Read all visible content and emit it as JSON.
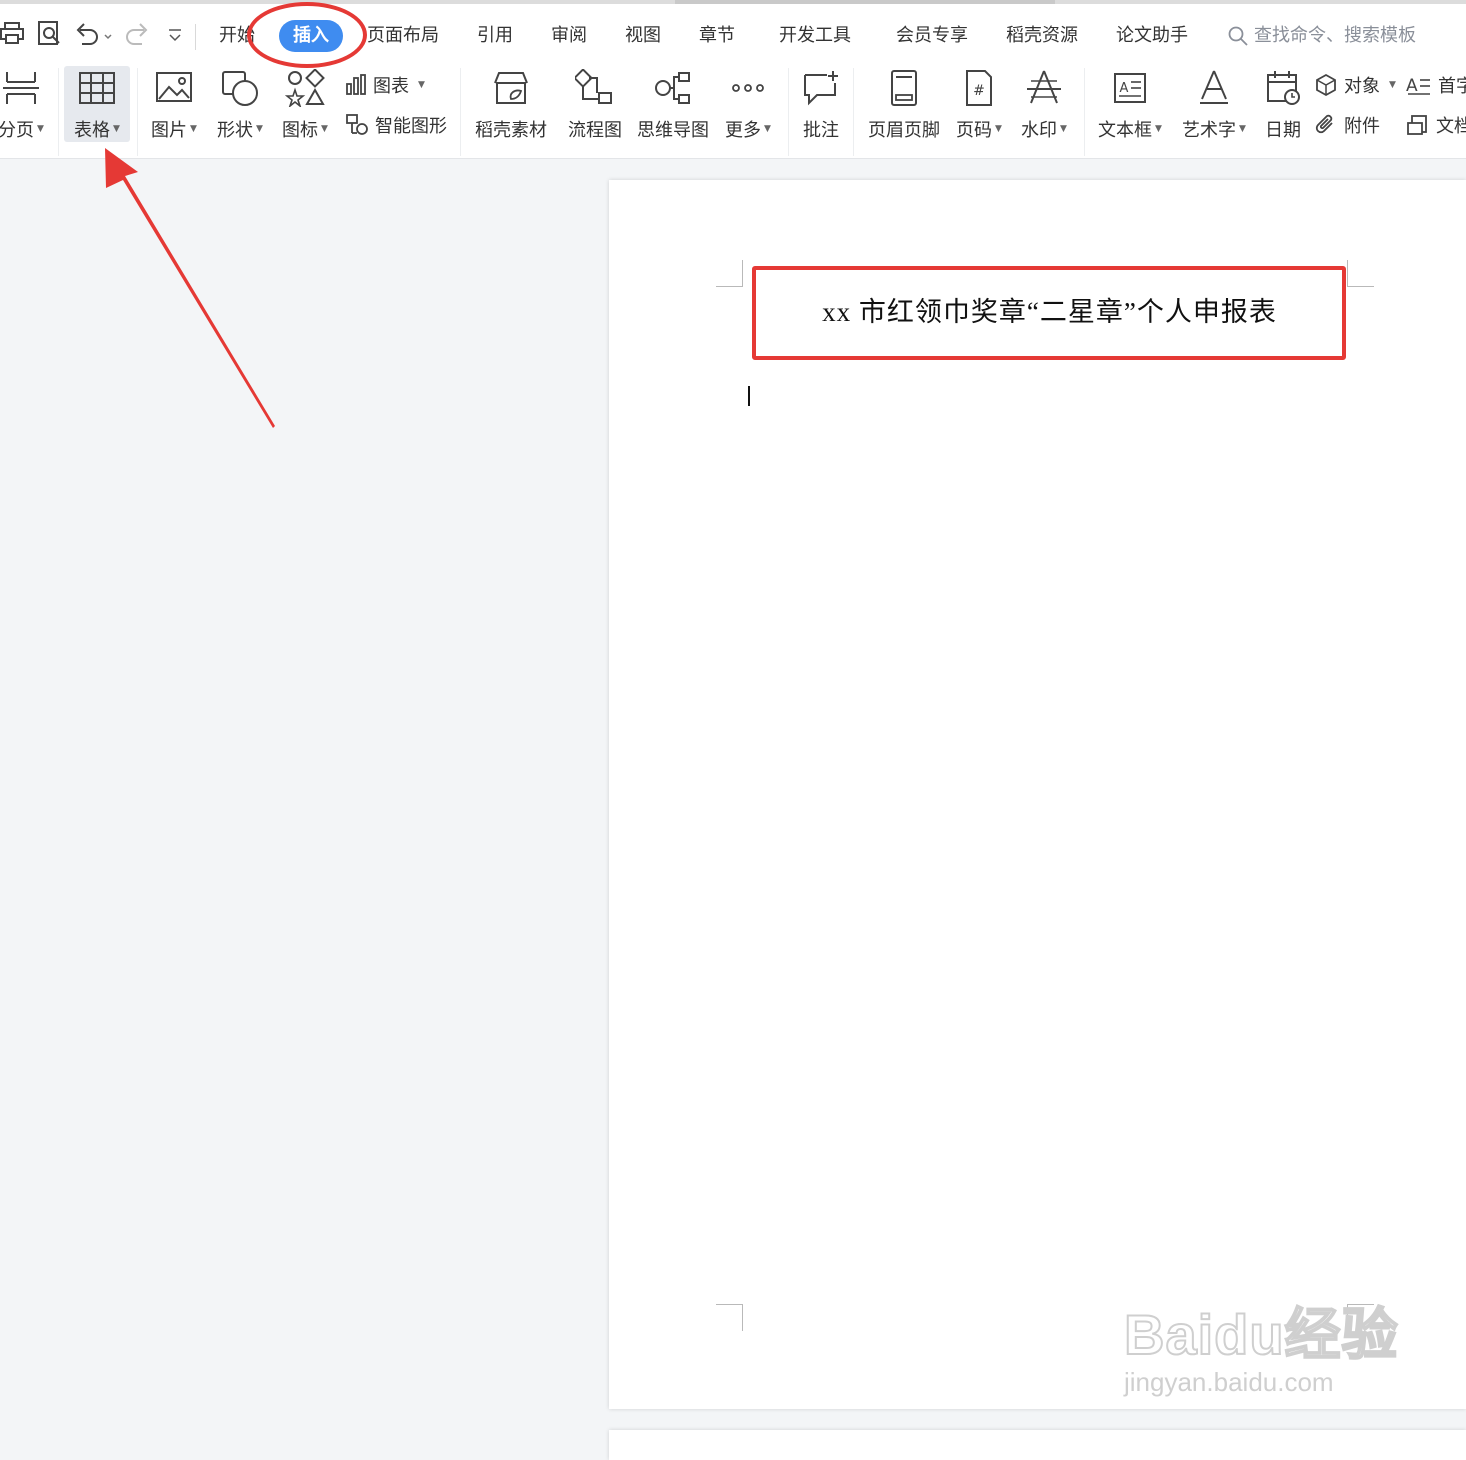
{
  "tabs": {
    "start": "开始",
    "insert": "插入",
    "layout": "页面布局",
    "references": "引用",
    "review": "审阅",
    "view": "视图",
    "chapter": "章节",
    "developer": "开发工具",
    "member": "会员专享",
    "daoke": "稻壳资源",
    "thesis": "论文助手"
  },
  "search": {
    "placeholder": "查找命令、搜索模板"
  },
  "ribbon": {
    "page_break": "分页",
    "table": "表格",
    "picture": "图片",
    "shape": "形状",
    "icon": "图标",
    "chart": "图表",
    "smart_art": "智能图形",
    "daoke_material": "稻壳素材",
    "flowchart": "流程图",
    "mindmap": "思维导图",
    "more": "更多",
    "comment": "批注",
    "header_footer": "页眉页脚",
    "page_number": "页码",
    "watermark": "水印",
    "textbox": "文本框",
    "wordart": "艺术字",
    "date": "日期",
    "object": "对象",
    "attachment": "附件",
    "dropcap": "首字",
    "doc_part": "文档"
  },
  "document": {
    "title": "xx 市红领巾奖章“二星章”个人申报表"
  },
  "watermark": {
    "brand": "Baidu经验",
    "url": "jingyan.baidu.com"
  },
  "colors": {
    "accent": "#3f8cf0",
    "annotation": "#e53935"
  }
}
